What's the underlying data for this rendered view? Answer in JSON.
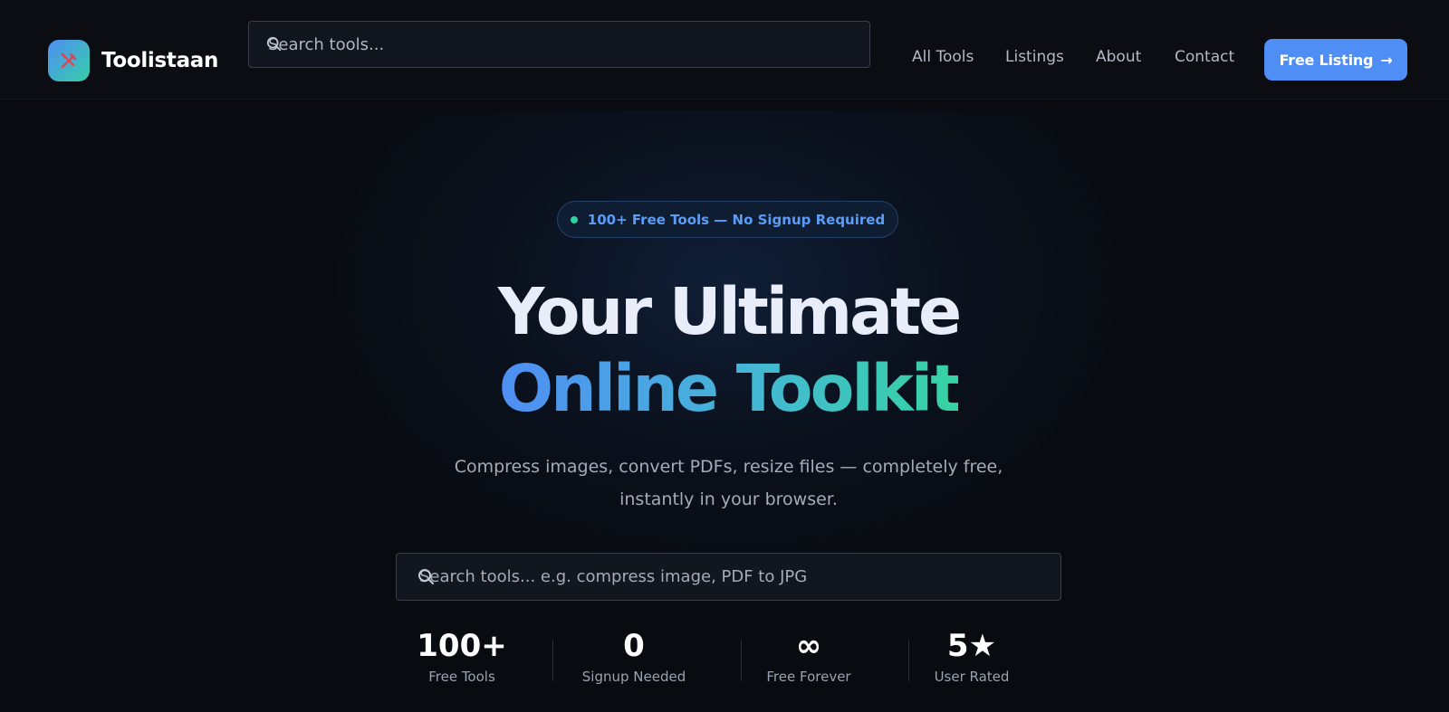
{
  "brand": {
    "name": "Toolistaan"
  },
  "header": {
    "search_placeholder": "Search tools...",
    "nav": [
      "All Tools",
      "Listings",
      "About",
      "Contact"
    ],
    "cta_label": "Free Listing",
    "cta_arrow": "→"
  },
  "hero": {
    "badge": "100+ Free Tools — No Signup Required",
    "headline_line1": "Your Ultimate",
    "headline_line2": "Online Toolkit",
    "subtitle_line1": "Compress images, convert PDFs, resize files — completely free,",
    "subtitle_line2": "instantly in your browser.",
    "search_placeholder": "Search tools... e.g. compress image, PDF to JPG",
    "stats": [
      {
        "value": "100+",
        "label": "Free Tools"
      },
      {
        "value": "0",
        "label": "Signup Needed"
      },
      {
        "value": "∞",
        "label": "Free Forever"
      },
      {
        "value": "5★",
        "label": "User Rated"
      }
    ]
  },
  "colors": {
    "accent_blue": "#4f8ef4",
    "accent_green": "#36d3a2",
    "background": "#090b10"
  },
  "icons": [
    "tools-icon",
    "search-icon",
    "arrow-right-icon",
    "status-dot-icon"
  ]
}
